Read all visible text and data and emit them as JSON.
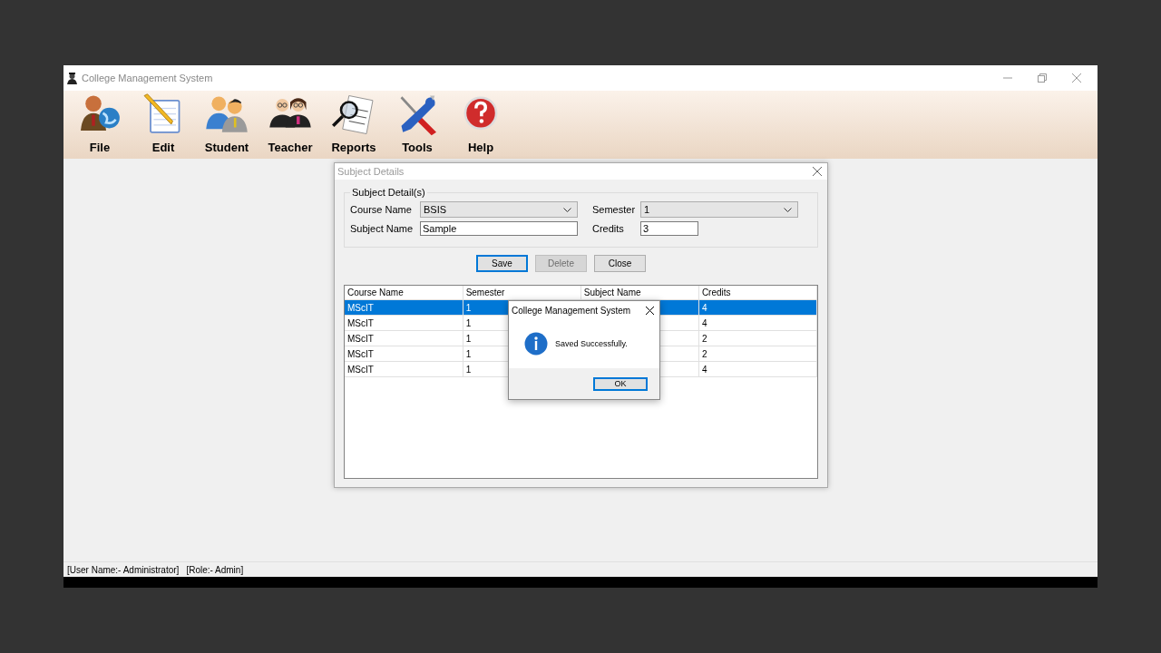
{
  "window": {
    "title": "College Management System"
  },
  "toolbar": [
    {
      "label": "File",
      "kind": "person-globe"
    },
    {
      "label": "Edit",
      "kind": "notepad"
    },
    {
      "label": "Student",
      "kind": "two-people"
    },
    {
      "label": "Teacher",
      "kind": "two-teachers"
    },
    {
      "label": "Reports",
      "kind": "report"
    },
    {
      "label": "Tools",
      "kind": "tools"
    },
    {
      "label": "Help",
      "kind": "help"
    }
  ],
  "subject_dialog": {
    "title": "Subject Details",
    "group_title": "Subject Detail(s)",
    "fields": [
      {
        "kind": "dropdown",
        "label": "Course Name",
        "value": "BSIS"
      },
      {
        "kind": "dropdown",
        "label": "Semester",
        "value": "1"
      },
      {
        "kind": "text",
        "label": "Subject Name",
        "value": "Sample"
      },
      {
        "kind": "text",
        "label": "Credits",
        "value": "3"
      }
    ],
    "buttons": [
      {
        "label": "Save",
        "disabled": false,
        "focused": true
      },
      {
        "label": "Delete",
        "disabled": true,
        "focused": false
      },
      {
        "label": "Close",
        "disabled": false,
        "focused": false
      }
    ],
    "table": {
      "columns": [
        "Course Name",
        "Semester",
        "Subject Name",
        "Credits"
      ],
      "rows": [
        {
          "course_name": "MScIT",
          "semester": "1",
          "credits": "4",
          "selected": true
        },
        {
          "course_name": "MScIT",
          "semester": "1",
          "credits": "4",
          "selected": false
        },
        {
          "course_name": "MScIT",
          "semester": "1",
          "credits": "2",
          "selected": false
        },
        {
          "course_name": "MScIT",
          "semester": "1",
          "credits": "2",
          "selected": false
        },
        {
          "course_name": "MScIT",
          "semester": "1",
          "credits": "4",
          "selected": false
        }
      ]
    }
  },
  "message_box": {
    "title": "College Management System",
    "message": "Saved Successfully.",
    "button": "OK"
  },
  "status_bar": {
    "user": "[User Name:- Administrator]",
    "role": "[Role:- Admin]"
  }
}
